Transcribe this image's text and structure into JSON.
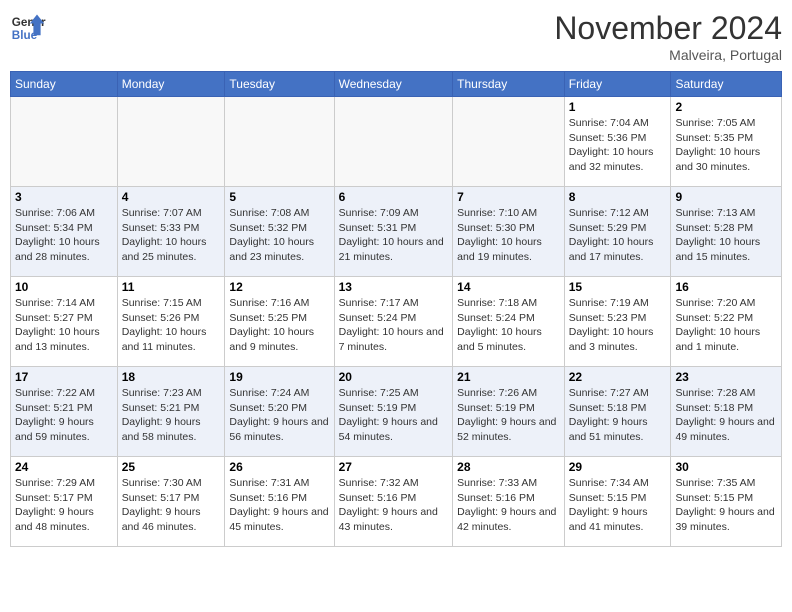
{
  "header": {
    "logo_line1": "General",
    "logo_line2": "Blue",
    "month_title": "November 2024",
    "location": "Malveira, Portugal"
  },
  "weekdays": [
    "Sunday",
    "Monday",
    "Tuesday",
    "Wednesday",
    "Thursday",
    "Friday",
    "Saturday"
  ],
  "weeks": [
    [
      {
        "day": "",
        "info": ""
      },
      {
        "day": "",
        "info": ""
      },
      {
        "day": "",
        "info": ""
      },
      {
        "day": "",
        "info": ""
      },
      {
        "day": "",
        "info": ""
      },
      {
        "day": "1",
        "info": "Sunrise: 7:04 AM\nSunset: 5:36 PM\nDaylight: 10 hours and 32 minutes."
      },
      {
        "day": "2",
        "info": "Sunrise: 7:05 AM\nSunset: 5:35 PM\nDaylight: 10 hours and 30 minutes."
      }
    ],
    [
      {
        "day": "3",
        "info": "Sunrise: 7:06 AM\nSunset: 5:34 PM\nDaylight: 10 hours and 28 minutes."
      },
      {
        "day": "4",
        "info": "Sunrise: 7:07 AM\nSunset: 5:33 PM\nDaylight: 10 hours and 25 minutes."
      },
      {
        "day": "5",
        "info": "Sunrise: 7:08 AM\nSunset: 5:32 PM\nDaylight: 10 hours and 23 minutes."
      },
      {
        "day": "6",
        "info": "Sunrise: 7:09 AM\nSunset: 5:31 PM\nDaylight: 10 hours and 21 minutes."
      },
      {
        "day": "7",
        "info": "Sunrise: 7:10 AM\nSunset: 5:30 PM\nDaylight: 10 hours and 19 minutes."
      },
      {
        "day": "8",
        "info": "Sunrise: 7:12 AM\nSunset: 5:29 PM\nDaylight: 10 hours and 17 minutes."
      },
      {
        "day": "9",
        "info": "Sunrise: 7:13 AM\nSunset: 5:28 PM\nDaylight: 10 hours and 15 minutes."
      }
    ],
    [
      {
        "day": "10",
        "info": "Sunrise: 7:14 AM\nSunset: 5:27 PM\nDaylight: 10 hours and 13 minutes."
      },
      {
        "day": "11",
        "info": "Sunrise: 7:15 AM\nSunset: 5:26 PM\nDaylight: 10 hours and 11 minutes."
      },
      {
        "day": "12",
        "info": "Sunrise: 7:16 AM\nSunset: 5:25 PM\nDaylight: 10 hours and 9 minutes."
      },
      {
        "day": "13",
        "info": "Sunrise: 7:17 AM\nSunset: 5:24 PM\nDaylight: 10 hours and 7 minutes."
      },
      {
        "day": "14",
        "info": "Sunrise: 7:18 AM\nSunset: 5:24 PM\nDaylight: 10 hours and 5 minutes."
      },
      {
        "day": "15",
        "info": "Sunrise: 7:19 AM\nSunset: 5:23 PM\nDaylight: 10 hours and 3 minutes."
      },
      {
        "day": "16",
        "info": "Sunrise: 7:20 AM\nSunset: 5:22 PM\nDaylight: 10 hours and 1 minute."
      }
    ],
    [
      {
        "day": "17",
        "info": "Sunrise: 7:22 AM\nSunset: 5:21 PM\nDaylight: 9 hours and 59 minutes."
      },
      {
        "day": "18",
        "info": "Sunrise: 7:23 AM\nSunset: 5:21 PM\nDaylight: 9 hours and 58 minutes."
      },
      {
        "day": "19",
        "info": "Sunrise: 7:24 AM\nSunset: 5:20 PM\nDaylight: 9 hours and 56 minutes."
      },
      {
        "day": "20",
        "info": "Sunrise: 7:25 AM\nSunset: 5:19 PM\nDaylight: 9 hours and 54 minutes."
      },
      {
        "day": "21",
        "info": "Sunrise: 7:26 AM\nSunset: 5:19 PM\nDaylight: 9 hours and 52 minutes."
      },
      {
        "day": "22",
        "info": "Sunrise: 7:27 AM\nSunset: 5:18 PM\nDaylight: 9 hours and 51 minutes."
      },
      {
        "day": "23",
        "info": "Sunrise: 7:28 AM\nSunset: 5:18 PM\nDaylight: 9 hours and 49 minutes."
      }
    ],
    [
      {
        "day": "24",
        "info": "Sunrise: 7:29 AM\nSunset: 5:17 PM\nDaylight: 9 hours and 48 minutes."
      },
      {
        "day": "25",
        "info": "Sunrise: 7:30 AM\nSunset: 5:17 PM\nDaylight: 9 hours and 46 minutes."
      },
      {
        "day": "26",
        "info": "Sunrise: 7:31 AM\nSunset: 5:16 PM\nDaylight: 9 hours and 45 minutes."
      },
      {
        "day": "27",
        "info": "Sunrise: 7:32 AM\nSunset: 5:16 PM\nDaylight: 9 hours and 43 minutes."
      },
      {
        "day": "28",
        "info": "Sunrise: 7:33 AM\nSunset: 5:16 PM\nDaylight: 9 hours and 42 minutes."
      },
      {
        "day": "29",
        "info": "Sunrise: 7:34 AM\nSunset: 5:15 PM\nDaylight: 9 hours and 41 minutes."
      },
      {
        "day": "30",
        "info": "Sunrise: 7:35 AM\nSunset: 5:15 PM\nDaylight: 9 hours and 39 minutes."
      }
    ]
  ]
}
